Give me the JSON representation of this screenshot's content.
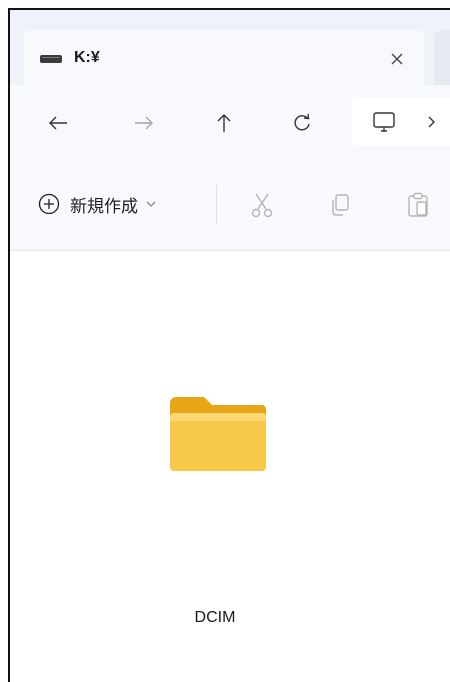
{
  "tab": {
    "title": "K:¥",
    "drive_icon": "drive-icon",
    "close_icon": "close-icon"
  },
  "nav": {
    "back_icon": "arrow-left-icon",
    "forward_icon": "arrow-right-icon",
    "up_icon": "arrow-up-icon",
    "refresh_icon": "refresh-icon",
    "computer_icon": "monitor-icon",
    "more_icon": "chevron-right-icon"
  },
  "toolbar": {
    "new_label": "新規作成",
    "new_icon": "plus-circle-icon",
    "cut_icon": "scissors-icon",
    "copy_icon": "copy-icon",
    "paste_icon": "clipboard-icon"
  },
  "files": [
    {
      "name": "DCIM",
      "type": "folder"
    }
  ],
  "colors": {
    "folder": "#f8c84a",
    "folder_back": "#e8a617",
    "chrome_bg": "#f7f9fc",
    "tab_strip": "#eef2f9"
  }
}
